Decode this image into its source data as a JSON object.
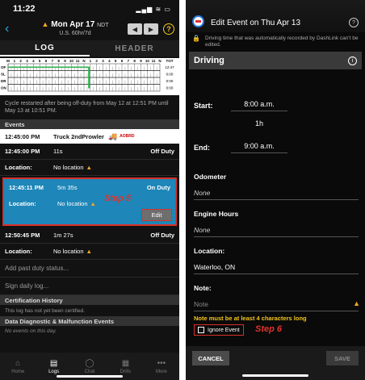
{
  "left": {
    "status": {
      "time": "11:22",
      "signal": "▂▄▆ ≋ ▭"
    },
    "nav": {
      "back_icon": "‹",
      "date": "Mon Apr 17",
      "tz": "NDT",
      "rule": "U.S. 60hr/7d",
      "warn_icon": "▲",
      "prev": "◀",
      "next": "▶",
      "help": "?"
    },
    "tabs": {
      "log": "LOG",
      "header": "HEADER"
    },
    "grid": {
      "rows": [
        "OF",
        "SL",
        "DR",
        "ON"
      ],
      "header": [
        "M",
        "1",
        "2",
        "3",
        "4",
        "5",
        "6",
        "7",
        "8",
        "9",
        "10",
        "11",
        "N",
        "1",
        "2",
        "3",
        "4",
        "5",
        "6",
        "7",
        "8",
        "9",
        "10",
        "11",
        "N"
      ],
      "tot_label": "TOT",
      "totals": [
        "12:47",
        "0:00",
        "0:00",
        "0:00"
      ]
    },
    "cycle_text": "Cycle restarted after being off-duty from May 12 at 12:51 PM until May 13 at 10:51 PM.",
    "events_header": "Events",
    "truck_event": {
      "time": "12:45:00 PM",
      "label": "Truck 2ndProwler",
      "tag": "AOBRD"
    },
    "event1": {
      "time": "12:45:00 PM",
      "duration": "11s",
      "status": "Off Duty",
      "loc_label": "Location:",
      "loc_value": "No location"
    },
    "event2": {
      "time": "12:45:11 PM",
      "duration": "5m 35s",
      "status": "On Duty",
      "loc_label": "Location:",
      "loc_value": "No location",
      "step": "Step 5",
      "edit": "Edit"
    },
    "event3": {
      "time": "12:50:45 PM",
      "duration": "1m 27s",
      "status": "Off Duty",
      "loc_label": "Location:",
      "loc_value": "No location"
    },
    "add_duty": "Add past duty status...",
    "sign_log": "Sign daily log...",
    "cert_header": "Certification History",
    "cert_text": "This log has not yet been certified.",
    "diag_header": "Data Diagnostic & Malfunction Events",
    "no_events": "No events on this day.",
    "bottom_tabs": [
      {
        "icon": "⌂",
        "label": "Home"
      },
      {
        "icon": "▤",
        "label": "Logs"
      },
      {
        "icon": "◯",
        "label": "Chat"
      },
      {
        "icon": "▦",
        "label": "Drills"
      },
      {
        "icon": "•••",
        "label": "More"
      }
    ]
  },
  "right": {
    "title": "Edit Event on Thu Apr 13",
    "help": "?",
    "lock_icon": "🔒",
    "lock_note": "Driving time that was automatically recorded by DashLink can't be edited.",
    "status_title": "Driving",
    "info_icon": "i",
    "start_label": "Start:",
    "start_value": "8:00 a.m.",
    "duration": "1h",
    "end_label": "End:",
    "end_value": "9:00 a.m.",
    "odometer_label": "Odometer",
    "odometer_value": "None",
    "engine_label": "Engine Hours",
    "engine_value": "None",
    "location_label": "Location:",
    "location_value": "Waterloo, ON",
    "note_label": "Note:",
    "note_placeholder": "Note",
    "warn_icon": "▲",
    "note_error": "Note must be at least 4 characters long",
    "ignore_label": "Ignore Event",
    "step": "Step 6",
    "cancel": "CANCEL",
    "save": "SAVE"
  }
}
